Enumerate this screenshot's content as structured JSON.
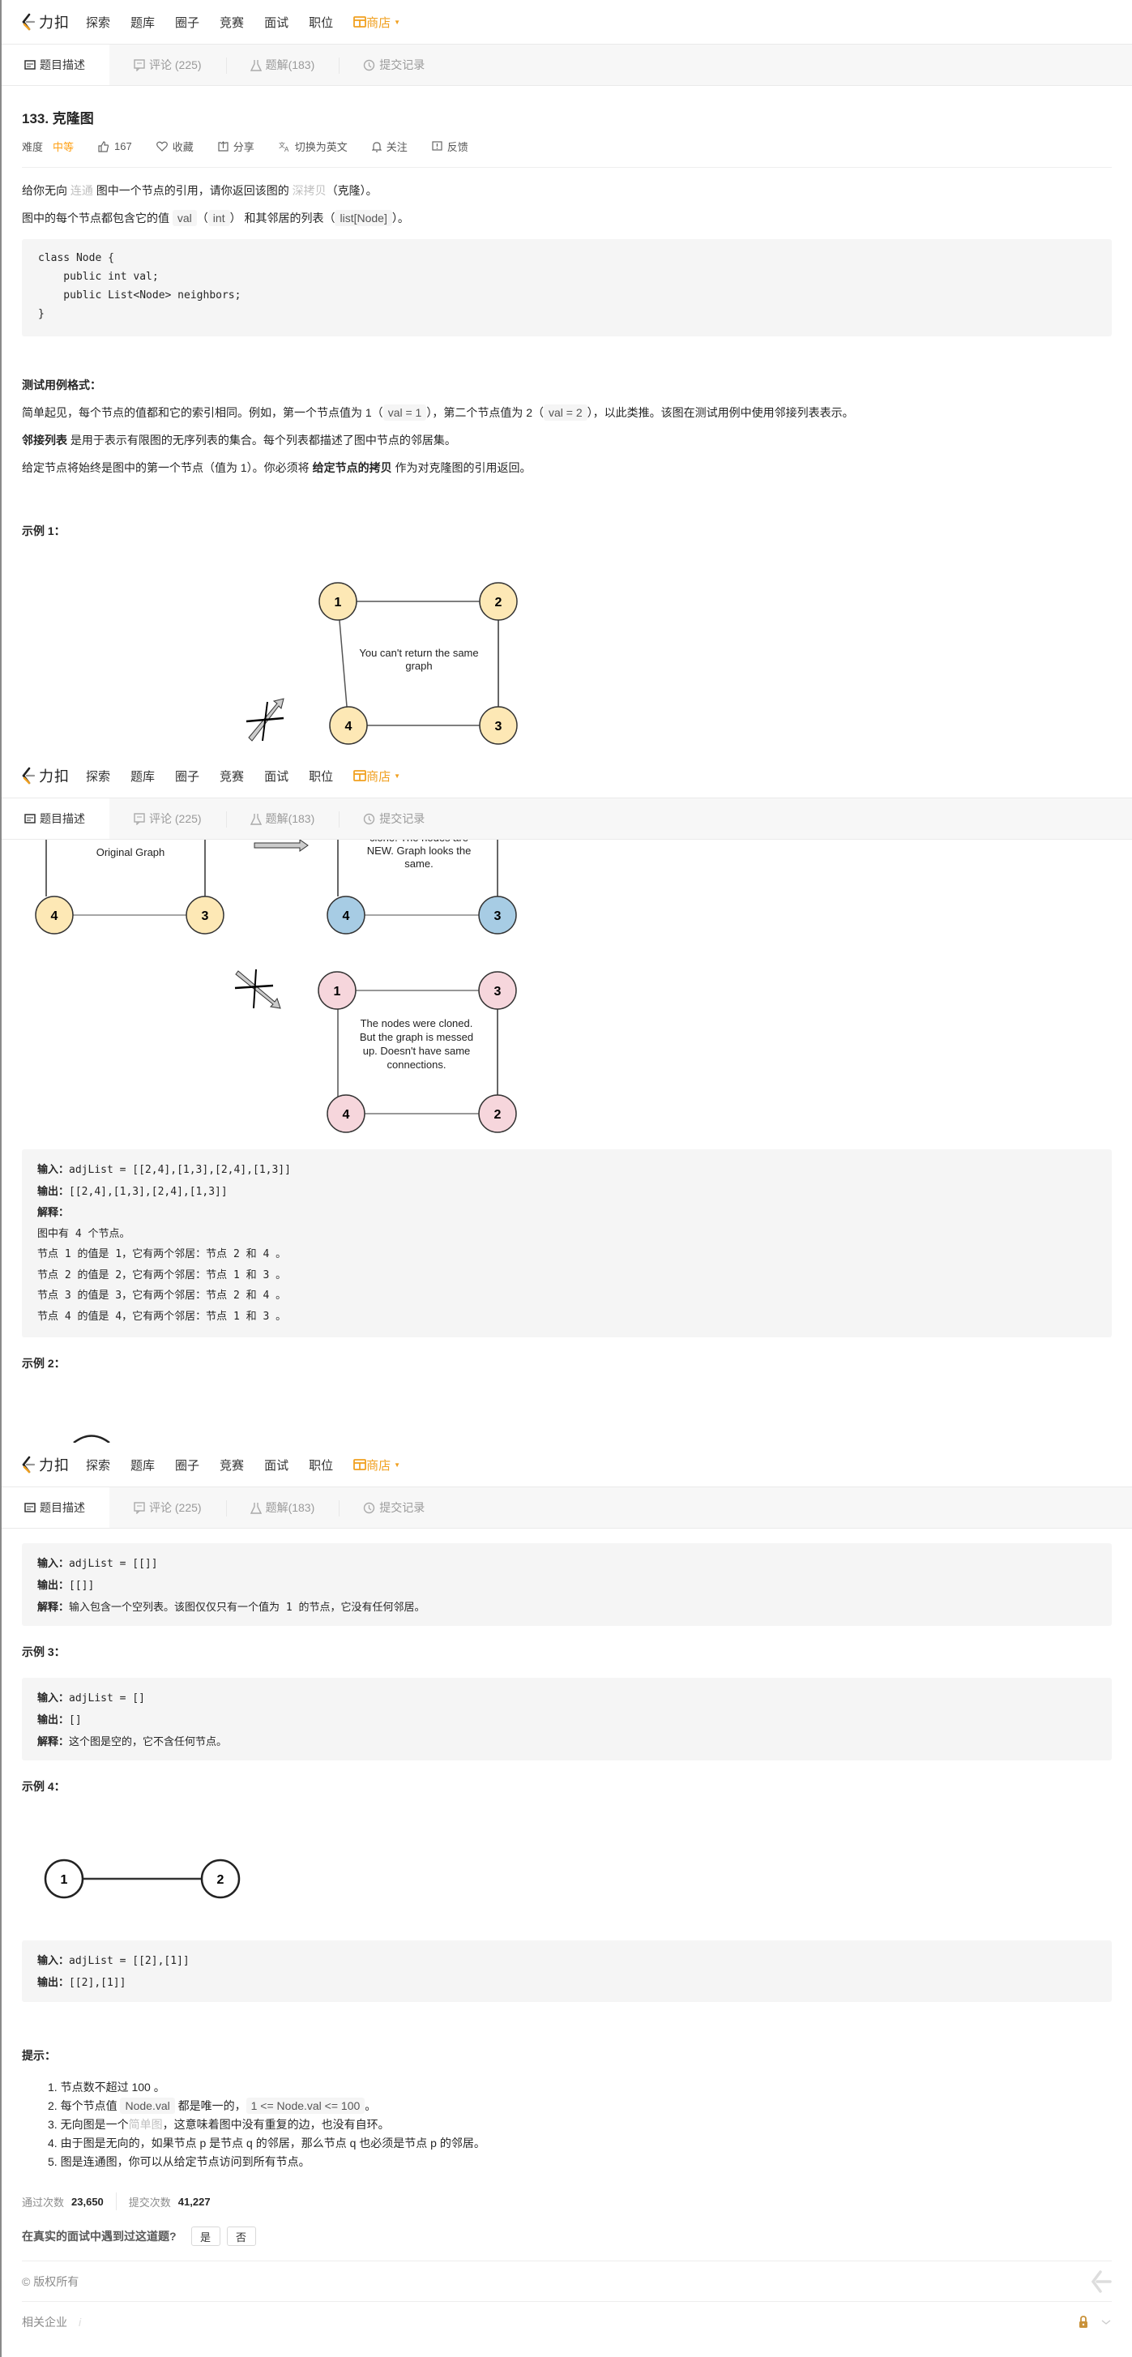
{
  "nav": {
    "logo_text": "力扣",
    "items": [
      "探索",
      "题库",
      "圈子",
      "竞赛",
      "面试",
      "职位"
    ],
    "store_label": "商店",
    "accent": "#ffa116"
  },
  "tabs": [
    {
      "label": "题目描述",
      "icon": "description-icon",
      "active": true
    },
    {
      "label": "评论 (225)",
      "icon": "comment-icon",
      "active": false
    },
    {
      "label": "题解(183)",
      "icon": "flask-icon",
      "active": false
    },
    {
      "label": "提交记录",
      "icon": "clock-icon",
      "active": false
    }
  ],
  "problem": {
    "title": "133. 克隆图",
    "difficulty_label": "难度",
    "difficulty": "中等",
    "likes": "167",
    "favorite": "收藏",
    "share": "分享",
    "translate": "切换为英文",
    "follow": "关注",
    "feedback": "反馈"
  },
  "desc": {
    "p1_a": "给你无向 ",
    "p1_link1": "连通",
    "p1_b": " 图中一个节点的引用，请你返回该图的 ",
    "p1_link2": "深拷贝",
    "p1_c": "（克隆）。",
    "p2_a": "图中的每个节点都包含它的值 ",
    "p2_code1": "val",
    "p2_b": "（",
    "p2_code2": "int",
    "p2_c": "） 和其邻居的列表（",
    "p2_code3": "list[Node]",
    "p2_d": "）。",
    "code": "class Node {\n    public int val;\n    public List<Node> neighbors;\n}",
    "format_title": "测试用例格式：",
    "f1_a": "简单起见，每个节点的值都和它的索引相同。例如，第一个节点值为 1（",
    "f1_code1": "val = 1",
    "f1_b": "），第二个节点值为 2（",
    "f1_code2": "val = 2",
    "f1_c": "），以此类推。该图在测试用例中使用邻接列表表示。",
    "f2_bold": "邻接列表",
    "f2_rest": " 是用于表示有限图的无序列表的集合。每个列表都描述了图中节点的邻居集。",
    "f3_a": "给定节点将始终是图中的第一个节点（值为 1）。你必须将 ",
    "f3_bold": "给定节点的拷贝",
    "f3_b": " 作为对克隆图的引用返回。"
  },
  "examples": [
    {
      "title": "示例 1：",
      "figure": {
        "note_same": "You can't return the same graph",
        "note_original": "Original Graph",
        "note_clone": "clone. The nodes are NEW. Graph looks the same.",
        "note_messed": "The nodes were cloned. But the graph is messed up. Doesn't have same connections.",
        "nodes_same": [
          "1",
          "2",
          "3",
          "4"
        ],
        "nodes_original": [
          "4",
          "3"
        ],
        "nodes_clone": [
          "4",
          "3"
        ],
        "nodes_messed": [
          "1",
          "3",
          "2",
          "4"
        ],
        "colors": {
          "original": "#fde8b5",
          "clone": "#a7cce4",
          "messed": "#f6d6dc"
        }
      },
      "input_label": "输入：",
      "input": "adjList = [[2,4],[1,3],[2,4],[1,3]]",
      "output_label": "输出：",
      "output": "[[2,4],[1,3],[2,4],[1,3]]",
      "explain_label": "解释：",
      "explain_lines": [
        "图中有 4 个节点。",
        "节点 1 的值是 1，它有两个邻居：节点 2 和 4 。",
        "节点 2 的值是 2，它有两个邻居：节点 1 和 3 。",
        "节点 3 的值是 3，它有两个邻居：节点 2 和 4 。",
        "节点 4 的值是 4，它有两个邻居：节点 1 和 3 。"
      ]
    },
    {
      "title": "示例 2：",
      "input_label": "输入：",
      "input": "adjList = [[]]",
      "output_label": "输出：",
      "output": "[[]]",
      "explain_label": "解释：",
      "explain": "输入包含一个空列表。该图仅仅只有一个值为 1 的节点，它没有任何邻居。"
    },
    {
      "title": "示例 3：",
      "input_label": "输入：",
      "input": "adjList = []",
      "output_label": "输出：",
      "output": "[]",
      "explain_label": "解释：",
      "explain": "这个图是空的，它不含任何节点。"
    },
    {
      "title": "示例 4：",
      "nodes": [
        "1",
        "2"
      ],
      "input_label": "输入：",
      "input": "adjList = [[2],[1]]",
      "output_label": "输出：",
      "output": "[[2],[1]]"
    }
  ],
  "tips": {
    "title": "提示：",
    "t1": "1. 节点数不超过 100 。",
    "t2_a": "2. 每个节点值 ",
    "t2_code1": "Node.val",
    "t2_b": " 都是唯一的，",
    "t2_code2": "1 <= Node.val <= 100",
    "t2_c": "。",
    "t3_a": "3. 无向图是一个",
    "t3_link": "简单图",
    "t3_b": "，这意味着图中没有重复的边，也没有自环。",
    "t4": "4. 由于图是无向的，如果节点 p 是节点 q 的邻居，那么节点 q 也必须是节点 p 的邻居。",
    "t5": "5. 图是连通图，你可以从给定节点访问到所有节点。"
  },
  "footer": {
    "accepted_label": "通过次数",
    "accepted": "23,650",
    "submissions_label": "提交次数",
    "submissions": "41,227",
    "interview_question": "在真实的面试中遇到过这道题?",
    "yes": "是",
    "no": "否",
    "copyright": "© 版权所有",
    "companies": "相关企业"
  }
}
